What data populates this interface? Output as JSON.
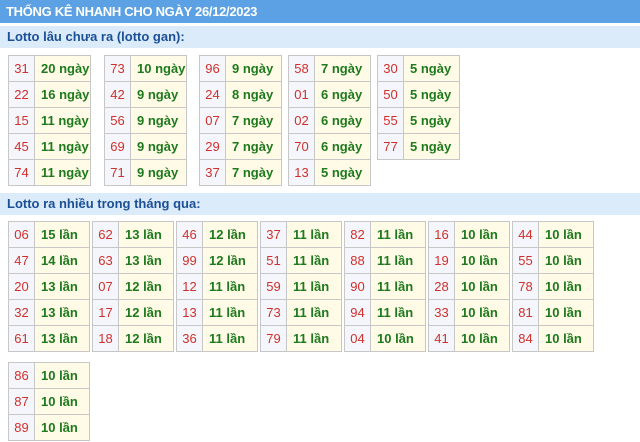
{
  "header": {
    "title": "THỐNG KÊ NHANH CHO NGÀY 26/12/2023"
  },
  "colors": {
    "header_bg": "#5ba1e3",
    "section_bg": "#dcebfa",
    "number": "#d0302d",
    "value": "#1d7a1d",
    "value_bg": "#fffbe6"
  },
  "gan": {
    "title": "Lotto lâu chưa ra (lotto gan):",
    "groups": [
      [
        [
          "31",
          "20 ngày"
        ],
        [
          "22",
          "16 ngày"
        ],
        [
          "15",
          "11 ngày"
        ],
        [
          "45",
          "11 ngày"
        ],
        [
          "74",
          "11 ngày"
        ]
      ],
      [
        [
          "73",
          "10 ngày"
        ],
        [
          "42",
          "9 ngày"
        ],
        [
          "56",
          "9 ngày"
        ],
        [
          "69",
          "9 ngày"
        ],
        [
          "71",
          "9 ngày"
        ]
      ],
      [
        [
          "96",
          "9 ngày"
        ],
        [
          "24",
          "8 ngày"
        ],
        [
          "07",
          "7 ngày"
        ],
        [
          "29",
          "7 ngày"
        ],
        [
          "37",
          "7 ngày"
        ]
      ],
      [
        [
          "58",
          "7 ngày"
        ],
        [
          "01",
          "6 ngày"
        ],
        [
          "02",
          "6 ngày"
        ],
        [
          "70",
          "6 ngày"
        ],
        [
          "13",
          "5 ngày"
        ]
      ],
      [
        [
          "30",
          "5 ngày"
        ],
        [
          "50",
          "5 ngày"
        ],
        [
          "55",
          "5 ngày"
        ],
        [
          "77",
          "5 ngày"
        ]
      ]
    ]
  },
  "nhieu": {
    "title": "Lotto ra nhiều trong tháng qua:",
    "groups": [
      [
        [
          "06",
          "15 lần"
        ],
        [
          "47",
          "14 lần"
        ],
        [
          "20",
          "13 lần"
        ],
        [
          "32",
          "13 lần"
        ],
        [
          "61",
          "13 lần"
        ]
      ],
      [
        [
          "62",
          "13 lần"
        ],
        [
          "63",
          "13 lần"
        ],
        [
          "07",
          "12 lần"
        ],
        [
          "17",
          "12 lần"
        ],
        [
          "18",
          "12 lần"
        ]
      ],
      [
        [
          "46",
          "12 lần"
        ],
        [
          "99",
          "12 lần"
        ],
        [
          "12",
          "11 lần"
        ],
        [
          "13",
          "11 lần"
        ],
        [
          "36",
          "11 lần"
        ]
      ],
      [
        [
          "37",
          "11 lần"
        ],
        [
          "51",
          "11 lần"
        ],
        [
          "59",
          "11 lần"
        ],
        [
          "73",
          "11 lần"
        ],
        [
          "79",
          "11 lần"
        ]
      ],
      [
        [
          "82",
          "11 lần"
        ],
        [
          "88",
          "11 lần"
        ],
        [
          "90",
          "11 lần"
        ],
        [
          "94",
          "11 lần"
        ],
        [
          "04",
          "10 lần"
        ]
      ],
      [
        [
          "16",
          "10 lần"
        ],
        [
          "19",
          "10 lần"
        ],
        [
          "28",
          "10 lần"
        ],
        [
          "33",
          "10 lần"
        ],
        [
          "41",
          "10 lần"
        ]
      ],
      [
        [
          "44",
          "10 lần"
        ],
        [
          "55",
          "10 lần"
        ],
        [
          "78",
          "10 lần"
        ],
        [
          "81",
          "10 lần"
        ],
        [
          "84",
          "10 lần"
        ]
      ],
      [
        [
          "86",
          "10 lần"
        ],
        [
          "87",
          "10 lần"
        ],
        [
          "89",
          "10 lần"
        ]
      ]
    ]
  }
}
